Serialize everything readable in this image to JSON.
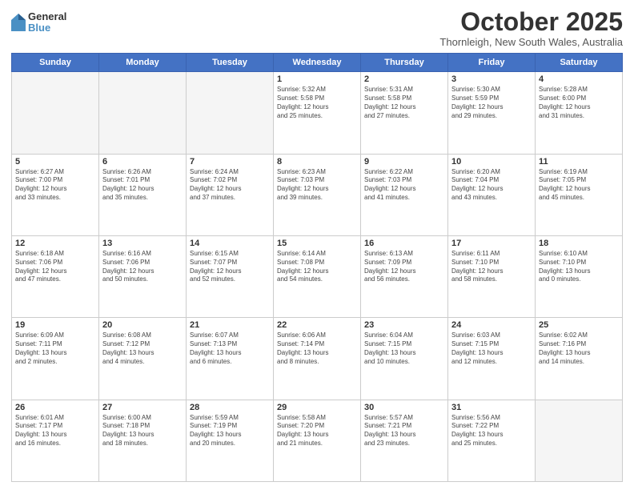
{
  "logo": {
    "general": "General",
    "blue": "Blue"
  },
  "header": {
    "month": "October 2025",
    "location": "Thornleigh, New South Wales, Australia"
  },
  "weekdays": [
    "Sunday",
    "Monday",
    "Tuesday",
    "Wednesday",
    "Thursday",
    "Friday",
    "Saturday"
  ],
  "weeks": [
    [
      {
        "day": "",
        "info": ""
      },
      {
        "day": "",
        "info": ""
      },
      {
        "day": "",
        "info": ""
      },
      {
        "day": "1",
        "info": "Sunrise: 5:32 AM\nSunset: 5:58 PM\nDaylight: 12 hours\nand 25 minutes."
      },
      {
        "day": "2",
        "info": "Sunrise: 5:31 AM\nSunset: 5:58 PM\nDaylight: 12 hours\nand 27 minutes."
      },
      {
        "day": "3",
        "info": "Sunrise: 5:30 AM\nSunset: 5:59 PM\nDaylight: 12 hours\nand 29 minutes."
      },
      {
        "day": "4",
        "info": "Sunrise: 5:28 AM\nSunset: 6:00 PM\nDaylight: 12 hours\nand 31 minutes."
      }
    ],
    [
      {
        "day": "5",
        "info": "Sunrise: 6:27 AM\nSunset: 7:00 PM\nDaylight: 12 hours\nand 33 minutes."
      },
      {
        "day": "6",
        "info": "Sunrise: 6:26 AM\nSunset: 7:01 PM\nDaylight: 12 hours\nand 35 minutes."
      },
      {
        "day": "7",
        "info": "Sunrise: 6:24 AM\nSunset: 7:02 PM\nDaylight: 12 hours\nand 37 minutes."
      },
      {
        "day": "8",
        "info": "Sunrise: 6:23 AM\nSunset: 7:03 PM\nDaylight: 12 hours\nand 39 minutes."
      },
      {
        "day": "9",
        "info": "Sunrise: 6:22 AM\nSunset: 7:03 PM\nDaylight: 12 hours\nand 41 minutes."
      },
      {
        "day": "10",
        "info": "Sunrise: 6:20 AM\nSunset: 7:04 PM\nDaylight: 12 hours\nand 43 minutes."
      },
      {
        "day": "11",
        "info": "Sunrise: 6:19 AM\nSunset: 7:05 PM\nDaylight: 12 hours\nand 45 minutes."
      }
    ],
    [
      {
        "day": "12",
        "info": "Sunrise: 6:18 AM\nSunset: 7:06 PM\nDaylight: 12 hours\nand 47 minutes."
      },
      {
        "day": "13",
        "info": "Sunrise: 6:16 AM\nSunset: 7:06 PM\nDaylight: 12 hours\nand 50 minutes."
      },
      {
        "day": "14",
        "info": "Sunrise: 6:15 AM\nSunset: 7:07 PM\nDaylight: 12 hours\nand 52 minutes."
      },
      {
        "day": "15",
        "info": "Sunrise: 6:14 AM\nSunset: 7:08 PM\nDaylight: 12 hours\nand 54 minutes."
      },
      {
        "day": "16",
        "info": "Sunrise: 6:13 AM\nSunset: 7:09 PM\nDaylight: 12 hours\nand 56 minutes."
      },
      {
        "day": "17",
        "info": "Sunrise: 6:11 AM\nSunset: 7:10 PM\nDaylight: 12 hours\nand 58 minutes."
      },
      {
        "day": "18",
        "info": "Sunrise: 6:10 AM\nSunset: 7:10 PM\nDaylight: 13 hours\nand 0 minutes."
      }
    ],
    [
      {
        "day": "19",
        "info": "Sunrise: 6:09 AM\nSunset: 7:11 PM\nDaylight: 13 hours\nand 2 minutes."
      },
      {
        "day": "20",
        "info": "Sunrise: 6:08 AM\nSunset: 7:12 PM\nDaylight: 13 hours\nand 4 minutes."
      },
      {
        "day": "21",
        "info": "Sunrise: 6:07 AM\nSunset: 7:13 PM\nDaylight: 13 hours\nand 6 minutes."
      },
      {
        "day": "22",
        "info": "Sunrise: 6:06 AM\nSunset: 7:14 PM\nDaylight: 13 hours\nand 8 minutes."
      },
      {
        "day": "23",
        "info": "Sunrise: 6:04 AM\nSunset: 7:15 PM\nDaylight: 13 hours\nand 10 minutes."
      },
      {
        "day": "24",
        "info": "Sunrise: 6:03 AM\nSunset: 7:15 PM\nDaylight: 13 hours\nand 12 minutes."
      },
      {
        "day": "25",
        "info": "Sunrise: 6:02 AM\nSunset: 7:16 PM\nDaylight: 13 hours\nand 14 minutes."
      }
    ],
    [
      {
        "day": "26",
        "info": "Sunrise: 6:01 AM\nSunset: 7:17 PM\nDaylight: 13 hours\nand 16 minutes."
      },
      {
        "day": "27",
        "info": "Sunrise: 6:00 AM\nSunset: 7:18 PM\nDaylight: 13 hours\nand 18 minutes."
      },
      {
        "day": "28",
        "info": "Sunrise: 5:59 AM\nSunset: 7:19 PM\nDaylight: 13 hours\nand 20 minutes."
      },
      {
        "day": "29",
        "info": "Sunrise: 5:58 AM\nSunset: 7:20 PM\nDaylight: 13 hours\nand 21 minutes."
      },
      {
        "day": "30",
        "info": "Sunrise: 5:57 AM\nSunset: 7:21 PM\nDaylight: 13 hours\nand 23 minutes."
      },
      {
        "day": "31",
        "info": "Sunrise: 5:56 AM\nSunset: 7:22 PM\nDaylight: 13 hours\nand 25 minutes."
      },
      {
        "day": "",
        "info": ""
      }
    ]
  ]
}
